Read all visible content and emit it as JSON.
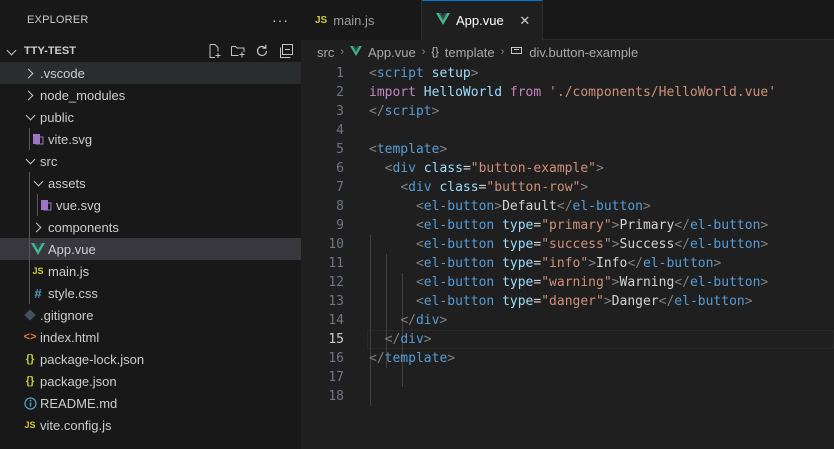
{
  "explorer": {
    "title": "EXPLORER",
    "more": "···",
    "project": "TTY-TEST",
    "items": [
      {
        "label": ".vscode",
        "type": "folder-collapsed"
      },
      {
        "label": "node_modules",
        "type": "folder-collapsed"
      },
      {
        "label": "public",
        "type": "folder-expanded"
      },
      {
        "label": "vite.svg",
        "type": "vue-svg-file"
      },
      {
        "label": "src",
        "type": "folder-expanded"
      },
      {
        "label": "assets",
        "type": "folder-expanded"
      },
      {
        "label": "vue.svg",
        "type": "vue-svg-file"
      },
      {
        "label": "components",
        "type": "folder-collapsed"
      },
      {
        "label": "App.vue",
        "type": "vue-file"
      },
      {
        "label": "main.js",
        "type": "js-file"
      },
      {
        "label": "style.css",
        "type": "css-file"
      },
      {
        "label": ".gitignore",
        "type": "git-file"
      },
      {
        "label": "index.html",
        "type": "html-file"
      },
      {
        "label": "package-lock.json",
        "type": "json-file"
      },
      {
        "label": "package.json",
        "type": "json-file"
      },
      {
        "label": "README.md",
        "type": "info-file"
      },
      {
        "label": "vite.config.js",
        "type": "js-file"
      }
    ]
  },
  "tabs": [
    {
      "label": "main.js",
      "icon": "JS",
      "active": false
    },
    {
      "label": "App.vue",
      "icon": "vue",
      "active": true
    }
  ],
  "breadcrumb": {
    "items": [
      "src",
      "App.vue",
      "template",
      "div.button-example"
    ]
  },
  "editor": {
    "current_line": 15,
    "line_numbers": [
      "1",
      "2",
      "3",
      "4",
      "5",
      "6",
      "7",
      "8",
      "9",
      "10",
      "11",
      "12",
      "13",
      "14",
      "15",
      "16",
      "17",
      "18"
    ]
  },
  "colors": {
    "accent": "#0078d4",
    "vue_green": "#41b883",
    "js_yellow": "#cbcb41",
    "css_blue": "#519aba",
    "html_orange": "#e37933",
    "json_yellow": "#cbcb41",
    "git_gray": "#41535b"
  }
}
